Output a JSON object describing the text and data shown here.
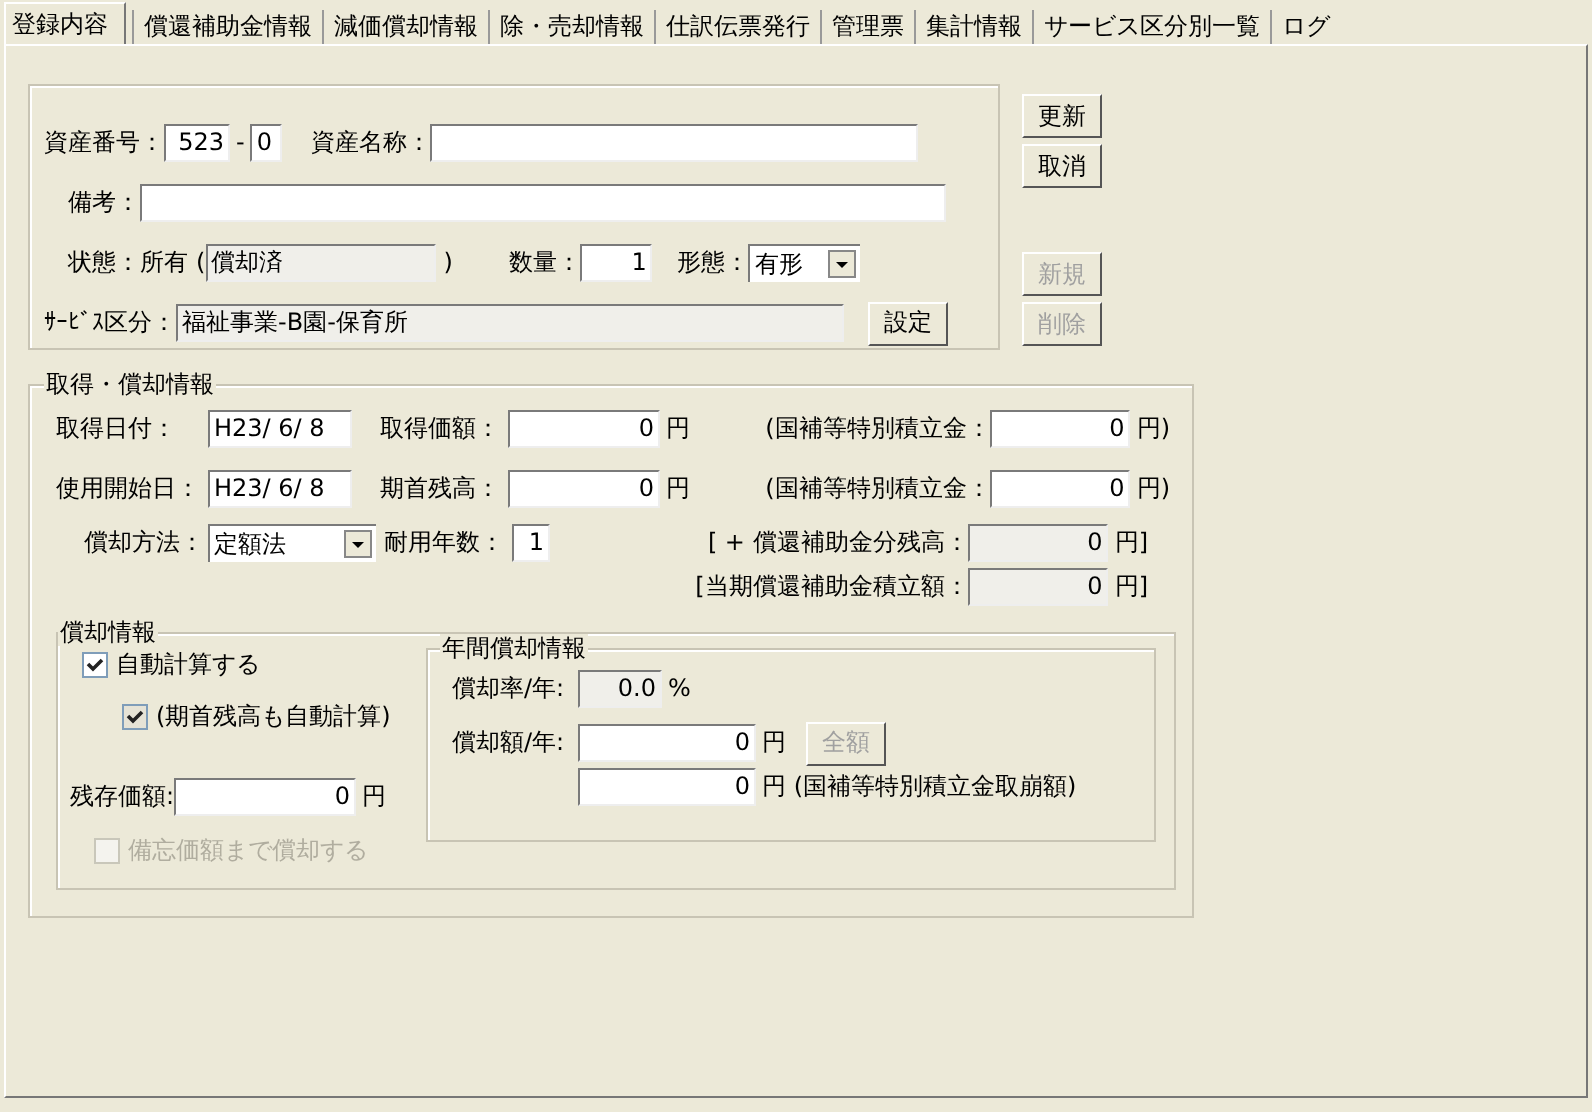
{
  "tabs": [
    {
      "label": "登録内容",
      "selected": true
    },
    {
      "label": "償還補助金情報",
      "selected": false
    },
    {
      "label": "減価償却情報",
      "selected": false
    },
    {
      "label": "除・売却情報",
      "selected": false
    },
    {
      "label": "仕訳伝票発行",
      "selected": false
    },
    {
      "label": "管理票",
      "selected": false
    },
    {
      "label": "集計情報",
      "selected": false
    },
    {
      "label": "サービス区分別一覧",
      "selected": false
    },
    {
      "label": "ログ",
      "selected": false
    }
  ],
  "basic": {
    "asset_no_label": "資産番号：",
    "asset_no": {
      "value": "523",
      "readonly": false
    },
    "asset_no_sep": "-",
    "asset_branch": {
      "value": "0",
      "readonly": false
    },
    "asset_name_label": "資産名称：",
    "asset_name": {
      "readonly": false
    },
    "note_label": "備考：",
    "note": {
      "readonly": false
    },
    "status_label": "状態：",
    "status_value": "所有",
    "status_open": "(",
    "status_detail": {
      "value": "償却済",
      "readonly": true
    },
    "status_close": ")",
    "qty_label": "数量：",
    "qty": {
      "value": "1",
      "readonly": false
    },
    "form_label": "形態：",
    "form": "有形",
    "service_label": "ｻｰﾋﾞｽ区分：",
    "service": {
      "value": "福祉事業-B園-保育所",
      "readonly": true
    },
    "set_button": {
      "label": "設定",
      "disabled": false
    }
  },
  "side_buttons": [
    {
      "label": "更新",
      "disabled": false
    },
    {
      "label": "取消",
      "disabled": false
    },
    {
      "label": "新規",
      "disabled": true
    },
    {
      "label": "削除",
      "disabled": true
    }
  ],
  "acquisition": {
    "title": "取得・償却情報",
    "acq_date_label": "取得日付：",
    "acq_date": {
      "value": "H23/ 6/ 8",
      "readonly": false
    },
    "acq_price_label": "取得価額：",
    "acq_price": {
      "value": "0",
      "readonly": false
    },
    "acq_price_unit": "円",
    "reserve1_label": "(国補等特別積立金：",
    "reserve1": {
      "value": "0",
      "readonly": false
    },
    "reserve1_unit": "円)",
    "start_date_label": "使用開始日：",
    "start_date": {
      "value": "H23/ 6/ 8",
      "readonly": false
    },
    "opening_label": "期首残高：",
    "opening": {
      "value": "0",
      "readonly": false
    },
    "opening_unit": "円",
    "reserve2_label": "(国補等特別積立金：",
    "reserve2": {
      "value": "0",
      "readonly": false
    },
    "reserve2_unit": "円)",
    "method_label": "償却方法：",
    "method": "定額法",
    "life_label": "耐用年数：",
    "life": {
      "value": "1",
      "readonly": false
    },
    "subsidy_balance_label": "[ + 償還補助金分残高：",
    "subsidy_balance": {
      "value": "0",
      "readonly": true
    },
    "subsidy_balance_unit": "円]",
    "subsidy_reserve_label": "[当期償還補助金積立額：",
    "subsidy_reserve": {
      "value": "0",
      "readonly": true
    },
    "subsidy_reserve_unit": "円]"
  },
  "depreciation": {
    "title": "償却情報",
    "checkboxes": [
      {
        "label": "自動計算する",
        "checked": true,
        "disabled": false
      },
      {
        "label": "(期首残高も自動計算)",
        "checked": true,
        "disabled": false
      }
    ],
    "residual_label": "残存価額:",
    "residual": {
      "value": "0",
      "readonly": false
    },
    "residual_unit": "円",
    "memo_checkbox": {
      "label": "備忘価額まで償却する",
      "checked": false,
      "disabled": true
    }
  },
  "annual": {
    "title": "年間償却情報",
    "rate_label": "償却率/年:",
    "rate": {
      "value": "0.0",
      "readonly": true
    },
    "rate_unit": "%",
    "amount_label": "償却額/年:",
    "amount": {
      "value": "0",
      "readonly": false
    },
    "amount_unit": "円",
    "full_button": {
      "label": "全額",
      "disabled": true
    },
    "reversal": {
      "value": "0",
      "readonly": false
    },
    "reversal_unit": "円 (国補等特別積立金取崩額)"
  }
}
